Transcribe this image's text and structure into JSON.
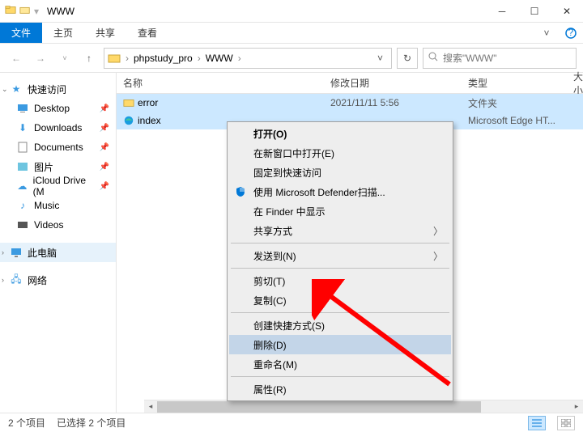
{
  "window": {
    "title": "WWW"
  },
  "ribbon": {
    "file": "文件",
    "home": "主页",
    "share": "共享",
    "view": "查看"
  },
  "breadcrumb": {
    "seg1": "phpstudy_pro",
    "seg2": "WWW"
  },
  "search": {
    "placeholder": "搜索\"WWW\""
  },
  "nav": {
    "quick": "快速访问",
    "desktop": "Desktop",
    "downloads": "Downloads",
    "documents": "Documents",
    "pictures": "图片",
    "icloud": "iCloud Drive (M",
    "music": "Music",
    "videos": "Videos",
    "thispc": "此电脑",
    "network": "网络"
  },
  "columns": {
    "name": "名称",
    "date": "修改日期",
    "type": "类型",
    "size": "大小"
  },
  "files": {
    "row0": {
      "name": "error",
      "date": "2021/11/11 5:56",
      "type": "文件夹"
    },
    "row1": {
      "name": "index",
      "date": "",
      "type": "Microsoft Edge HT..."
    }
  },
  "context": {
    "open": "打开(O)",
    "open_new": "在新窗口中打开(E)",
    "pin_quick": "固定到快速访问",
    "defender": "使用 Microsoft Defender扫描...",
    "finder": "在 Finder 中显示",
    "share": "共享方式",
    "sendto": "发送到(N)",
    "cut": "剪切(T)",
    "copy": "复制(C)",
    "shortcut": "创建快捷方式(S)",
    "delete": "删除(D)",
    "rename": "重命名(M)",
    "properties": "属性(R)"
  },
  "status": {
    "items": "2 个项目",
    "selected": "已选择 2 个项目"
  }
}
